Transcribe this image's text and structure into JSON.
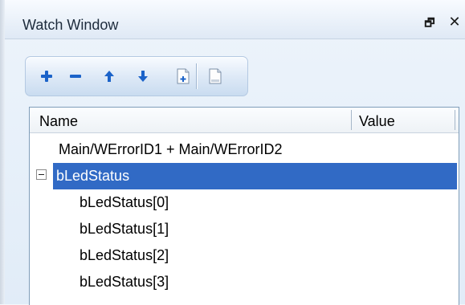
{
  "window": {
    "title": "Watch Window",
    "pin_icon": "dock-pin-icon",
    "close_icon": "close-icon"
  },
  "toolbar": {
    "buttons": [
      {
        "name": "add-watch-button",
        "icon": "plus-icon",
        "color": "#1b63c9"
      },
      {
        "name": "remove-watch-button",
        "icon": "minus-icon",
        "color": "#1b63c9"
      },
      {
        "name": "move-up-button",
        "icon": "arrow-up-icon",
        "color": "#1b63c9"
      },
      {
        "name": "move-down-button",
        "icon": "arrow-down-icon",
        "color": "#1b63c9"
      },
      {
        "name": "new-page-button",
        "icon": "new-page-icon"
      },
      {
        "name": "blank-page-button",
        "icon": "page-icon"
      }
    ]
  },
  "grid": {
    "columns": [
      "Name",
      "Value"
    ],
    "rows": [
      {
        "label": "Main/WErrorID1 + Main/WErrorID2",
        "value": "",
        "level": 0,
        "expander": false,
        "selected": false
      },
      {
        "label": "bLedStatus",
        "value": "",
        "level": 0,
        "expander": true,
        "selected": true
      },
      {
        "label": "bLedStatus[0]",
        "value": "",
        "level": 1,
        "expander": false,
        "selected": false
      },
      {
        "label": "bLedStatus[1]",
        "value": "",
        "level": 1,
        "expander": false,
        "selected": false
      },
      {
        "label": "bLedStatus[2]",
        "value": "",
        "level": 1,
        "expander": false,
        "selected": false
      },
      {
        "label": "bLedStatus[3]",
        "value": "",
        "level": 1,
        "expander": false,
        "selected": false
      }
    ]
  },
  "colors": {
    "selection": "#316ac5",
    "toolbar_icon_blue": "#1b63c9"
  }
}
